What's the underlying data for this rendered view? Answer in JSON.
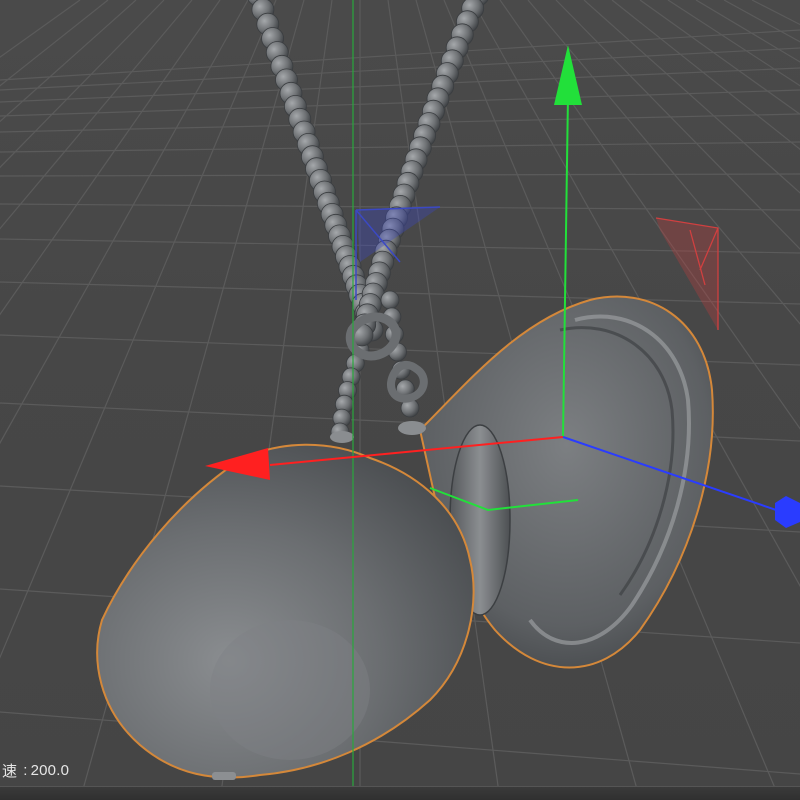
{
  "viewport": {
    "hud": {
      "speed_label": "速",
      "separator": ":",
      "speed_value": "200.0"
    }
  },
  "colors": {
    "axis_x": "#ff2020",
    "axis_y": "#22e03a",
    "axis_z": "#2a3cff",
    "selection_outline": "#d4883a",
    "object": "#6a6d70",
    "grid": "#5a5a5a"
  }
}
